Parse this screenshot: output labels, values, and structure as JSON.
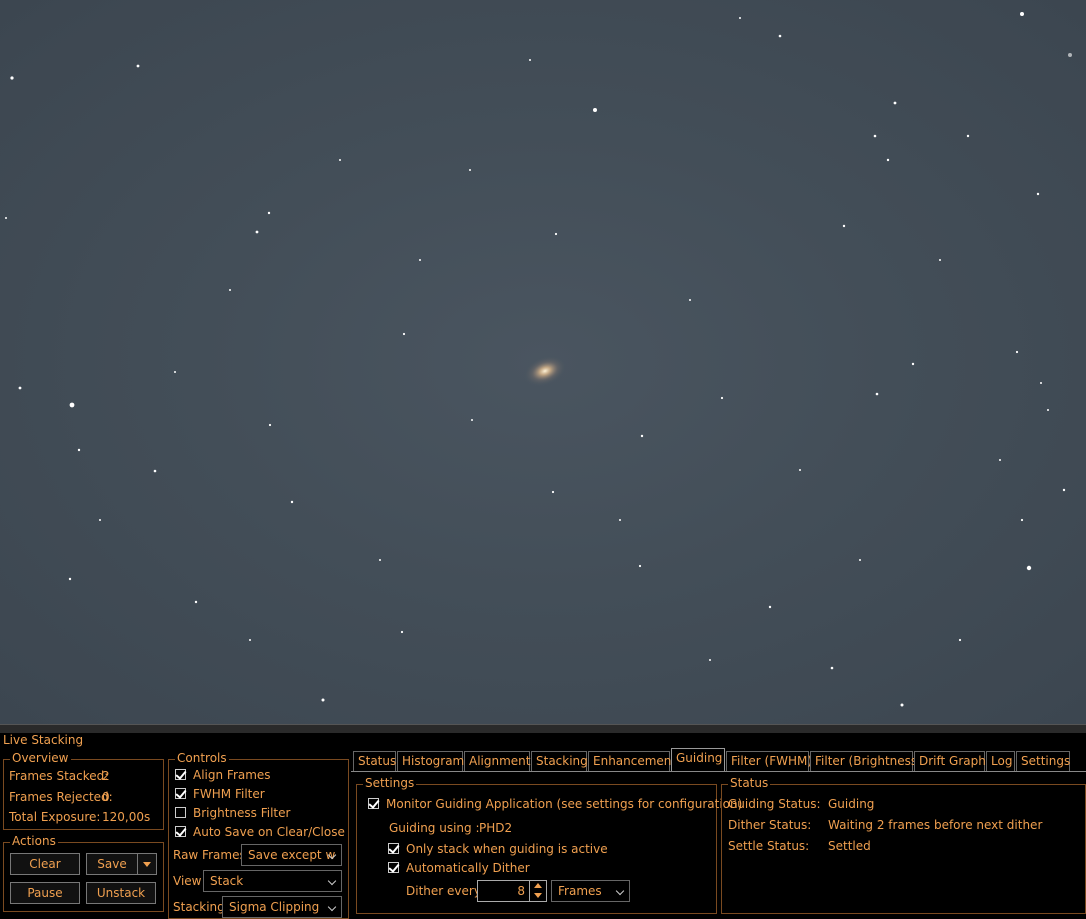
{
  "panel_title": "Live Stacking",
  "overview": {
    "legend": "Overview",
    "frames_stacked_label": "Frames Stacked:",
    "frames_stacked_value": "2",
    "frames_rejected_label": "Frames Rejected:",
    "frames_rejected_value": "0",
    "total_exposure_label": "Total Exposure:",
    "total_exposure_value": "120,00s"
  },
  "actions": {
    "legend": "Actions",
    "clear": "Clear",
    "save": "Save",
    "pause": "Pause",
    "unstack": "Unstack"
  },
  "controls": {
    "legend": "Controls",
    "align_frames": "Align Frames",
    "fwhm_filter": "FWHM Filter",
    "brightness_filter": "Brightness Filter",
    "auto_save": "Auto Save on Clear/Close",
    "raw_frames_label": "Raw Frames",
    "raw_frames_value": "Save except w",
    "view_label": "View",
    "view_value": "Stack",
    "stacking_label": "Stacking",
    "stacking_value": "Sigma Clipping"
  },
  "tabs": [
    "Status",
    "Histogram",
    "Alignment",
    "Stacking",
    "Enhancement",
    "Guiding",
    "Filter (FWHM)",
    "Filter (Brightness)",
    "Drift Graph",
    "Log",
    "Settings"
  ],
  "active_tab": "Guiding",
  "guiding": {
    "settings_legend": "Settings",
    "monitor_label": "Monitor Guiding Application (see settings for configuration)",
    "guiding_using_label": "Guiding using :",
    "guiding_using_value": "PHD2",
    "only_stack_label": "Only stack when guiding is active",
    "auto_dither_label": "Automatically Dither",
    "dither_every_label": "Dither every:",
    "dither_every_value": "8",
    "dither_unit": "Frames",
    "status_legend": "Status",
    "guiding_status_label": "Guiding Status:",
    "guiding_status_value": "Guiding",
    "dither_status_label": "Dither Status:",
    "dither_status_value": "Waiting 2 frames before next dither",
    "settle_status_label": "Settle Status:",
    "settle_status_value": "Settled"
  },
  "colors": {
    "accent": "#f0a050",
    "background": "#000000",
    "sky": "#434e58"
  }
}
